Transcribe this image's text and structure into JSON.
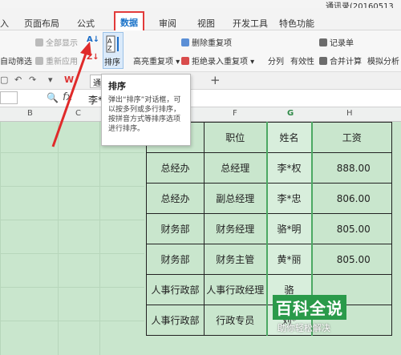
{
  "titlebar": {
    "file_title": "通讯录(20160513"
  },
  "menu": {
    "tabs": [
      "入",
      "页面布局",
      "公式",
      "数据",
      "审阅",
      "视图",
      "开发工具",
      "特色功能"
    ],
    "active": "数据"
  },
  "ribbon": {
    "show_all": "全部显示",
    "auto_filter": "自动筛选",
    "reapply": "重新应用",
    "sort": "排序",
    "highlight_dupes": "高亮重复项",
    "delete_dupes": "删除重复项",
    "reject_dupes": "拒绝录入重复项",
    "split": "分列",
    "validity": "有效性",
    "record_form": "记录单",
    "merge_calc": "合并计算",
    "sim_analysis": "模拟分析"
  },
  "qbar": {
    "doc_tab": "通",
    "plus": "+"
  },
  "formula_bar": {
    "value": "李*"
  },
  "columns": [
    "B",
    "C",
    "F",
    "G",
    "H"
  ],
  "tooltip": {
    "title": "排序",
    "body": "弹出“排序”对话框，可以按多列或多行排序，按拼音方式等排序选项进行排序。"
  },
  "table": {
    "header": [
      "部门",
      "职位",
      "姓名",
      "工资"
    ],
    "rows": [
      [
        "总经办",
        "总经理",
        "李*权",
        "888.00"
      ],
      [
        "总经办",
        "副总经理",
        "李*忠",
        "806.00"
      ],
      [
        "财务部",
        "财务经理",
        "骆*明",
        "805.00"
      ],
      [
        "财务部",
        "财务主管",
        "黄*丽",
        "805.00"
      ],
      [
        "人事行政部",
        "人事行政经理",
        "骆",
        ""
      ],
      [
        "人事行政部",
        "行政专员",
        "刘*",
        ""
      ]
    ]
  },
  "watermark": {
    "brand": "百科全说",
    "slogan": "助你轻松解决"
  },
  "colors": {
    "sheet_bg": "#c9e6cd",
    "active_tab_border": "#e23b3b",
    "arrow": "#e02a2a",
    "selected_col": "#4ca863"
  }
}
